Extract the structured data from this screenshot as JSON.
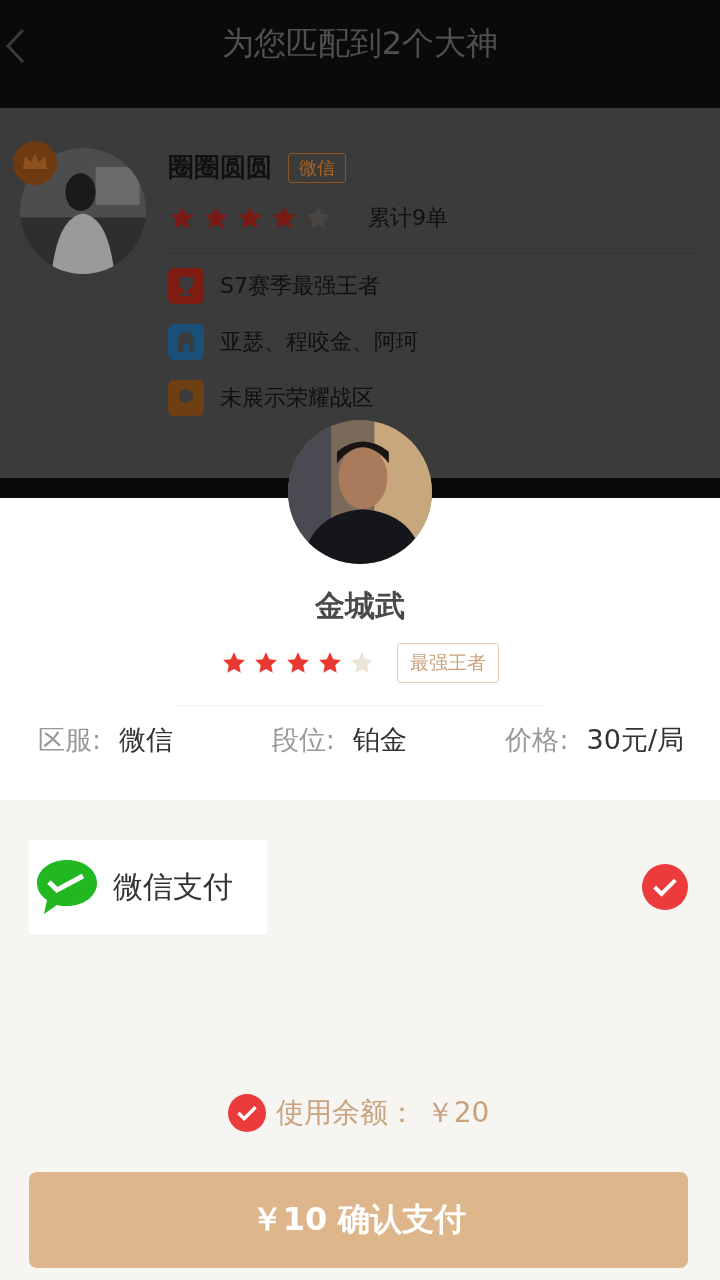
{
  "nav": {
    "title": "为您匹配到2个大神"
  },
  "match": {
    "name": "圈圈圆圆",
    "tag": "微信",
    "stars": 4,
    "orders": "累计9单",
    "facts": [
      {
        "kind": "trophy",
        "text": "S7赛季最强王者"
      },
      {
        "kind": "hero",
        "text": "亚瑟、程咬金、阿珂"
      },
      {
        "kind": "medal",
        "text": "未展示荣耀战区"
      }
    ]
  },
  "sheet": {
    "name": "金城武",
    "stars": 4,
    "badge": "最强王者",
    "info": [
      {
        "label": "区服:",
        "value": "微信"
      },
      {
        "label": "段位:",
        "value": "铂金"
      },
      {
        "label": "价格:",
        "value": "30元/局"
      }
    ]
  },
  "payment": {
    "methods": [
      {
        "label": "微信支付",
        "selected": true
      }
    ],
    "balance": {
      "checked": true,
      "label": "使用余额：",
      "amount": "￥20"
    },
    "confirm": "￥10 确认支付"
  }
}
